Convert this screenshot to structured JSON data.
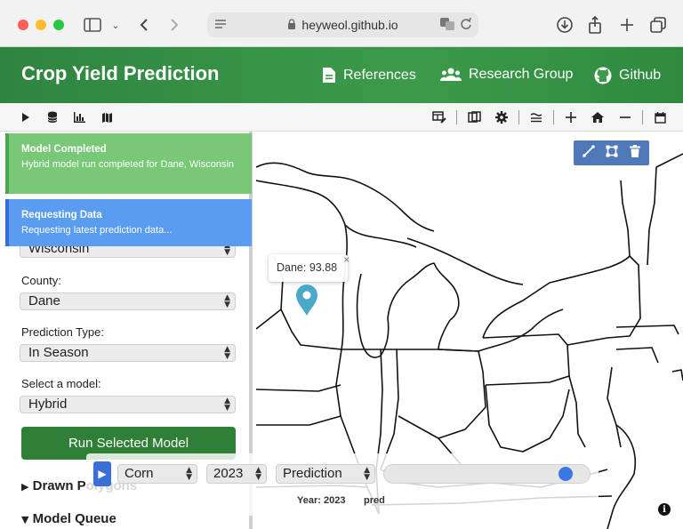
{
  "browser": {
    "url": "heyweol.github.io",
    "icons": [
      "sidebar-icon",
      "chevron-down-icon",
      "back-icon",
      "forward-icon",
      "translate-icon",
      "reload-icon",
      "download-icon",
      "share-icon",
      "new-tab-icon",
      "tabs-icon"
    ]
  },
  "header": {
    "title": "Crop Yield Prediction",
    "nav": [
      {
        "label": "References",
        "icon": "document-icon"
      },
      {
        "label": "Research Group",
        "icon": "users-icon"
      },
      {
        "label": "Github",
        "icon": "github-icon"
      }
    ]
  },
  "toasts": {
    "completed": {
      "title": "Model Completed",
      "message": "Hybrid model run completed for Dane, Wisconsin"
    },
    "requesting": {
      "title": "Requesting Data",
      "message": "Requesting latest prediction data..."
    }
  },
  "sidebar": {
    "state_value": "Wisconsin",
    "county_label": "County:",
    "county_value": "Dane",
    "prediction_type_label": "Prediction Type:",
    "prediction_type_value": "In Season",
    "model_label": "Select a model:",
    "model_value": "Hybrid",
    "run_button": "Run Selected Model",
    "drawn_polygons": "Drawn Polygons",
    "model_queue": "Model Queue"
  },
  "map": {
    "tooltip": "Dane: 93.88",
    "tooltip_close": "×"
  },
  "time_control": {
    "crop": "Corn",
    "year": "2023",
    "layer": "Prediction",
    "slider_fraction": 0.92,
    "status_year": "Year: 2023",
    "status_layer": "pred"
  },
  "colors": {
    "header_green": "#3c9a4a",
    "run_button": "#2f7f36",
    "toast_green": "#78c878",
    "toast_blue": "#5a9cf0",
    "draw_tools": "#4f78b8",
    "marker": "#4aa8c9"
  }
}
